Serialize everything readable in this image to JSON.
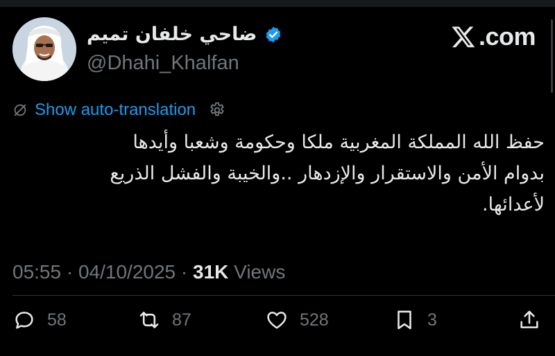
{
  "author": {
    "display_name": "ضاحي خلفان تميم",
    "handle": "@Dhahi_Khalfan",
    "verified": true,
    "verified_color": "#1d9bf0"
  },
  "brand": {
    "text": ".com",
    "icon": "x-logo-icon"
  },
  "translation": {
    "label": "Show auto-translation"
  },
  "tweet": {
    "lines": [
      "حفظ الله المملكة المغربية ملكا وحكومة وشعبا وأيدها",
      "بدوام الأمن والاستقرار والإزدهار ..والخيبة والفشل الذريع",
      "لأعدائها."
    ]
  },
  "meta": {
    "time": "05:55",
    "date": "04/10/2025",
    "sep": "·",
    "views_count": "31K",
    "views_label": "Views"
  },
  "actions": {
    "replies": "58",
    "reposts": "87",
    "likes": "528",
    "bookmarks": "3"
  },
  "colors": {
    "background": "#000000",
    "text": "#e7e9ea",
    "muted": "#71767b",
    "link": "#1d9bf0"
  }
}
